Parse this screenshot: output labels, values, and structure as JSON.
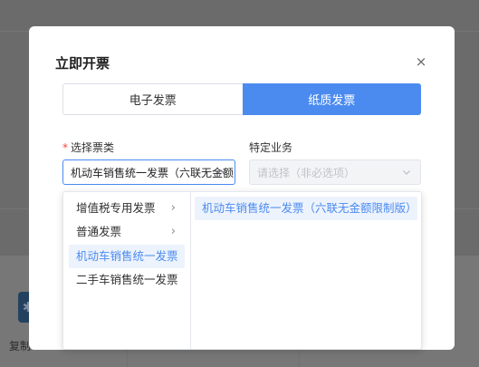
{
  "background": {
    "copy_text": "复制"
  },
  "dialog": {
    "title": "立即开票",
    "close_symbol": "×",
    "tabs": [
      {
        "label": "电子发票",
        "active": false
      },
      {
        "label": "纸质发票",
        "active": true
      }
    ],
    "invoice_type": {
      "label": "选择票类",
      "required_mark": "*",
      "value": "机动车销售统一发票（六联无金额限制版）",
      "expanded": true
    },
    "special_business": {
      "label": "特定业务",
      "placeholder": "请选择（非必选项）",
      "disabled": true
    },
    "cascader": {
      "level1": [
        {
          "label": "增值税专用发票",
          "has_children": true
        },
        {
          "label": "普通发票",
          "has_children": true
        },
        {
          "label": "机动车销售统一发票",
          "has_children": false,
          "active": true
        },
        {
          "label": "二手车销售统一发票",
          "has_children": false
        }
      ],
      "level2": [
        {
          "label": "机动车销售统一发票（六联无金额限制版）",
          "active": true
        }
      ]
    }
  },
  "colors": {
    "accent": "#4b8bf0",
    "required": "#f5463c"
  }
}
